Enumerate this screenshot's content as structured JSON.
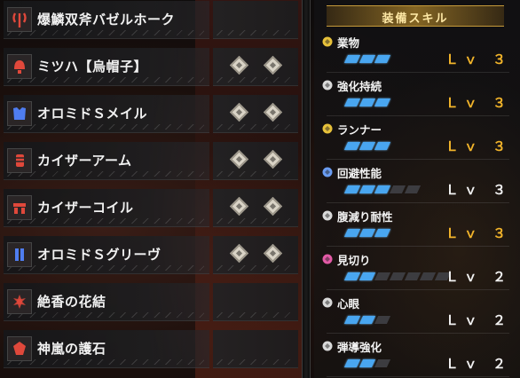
{
  "equipment": [
    {
      "name": "爆鱗双斧バゼルホーク",
      "icon": "weapon-switch-axe-icon",
      "icon_color": "#e0483b",
      "slots": 0
    },
    {
      "name": "ミツハ【烏帽子】",
      "icon": "helmet-icon",
      "icon_color": "#e0483b",
      "slots": 2
    },
    {
      "name": "オロミドＳメイル",
      "icon": "chest-armor-icon",
      "icon_color": "#4f7df0",
      "slots": 2
    },
    {
      "name": "カイザーアーム",
      "icon": "arm-armor-icon",
      "icon_color": "#e0483b",
      "slots": 2
    },
    {
      "name": "カイザーコイル",
      "icon": "waist-armor-icon",
      "icon_color": "#e0483b",
      "slots": 2
    },
    {
      "name": "オロミドＳグリーヴ",
      "icon": "leg-armor-icon",
      "icon_color": "#4f7df0",
      "slots": 2
    },
    {
      "name": "絶香の花結",
      "icon": "charm-flower-icon",
      "icon_color": "#e0483b",
      "slots": 0
    },
    {
      "name": "神嵐の護石",
      "icon": "talisman-icon",
      "icon_color": "#e0483b",
      "slots": 0
    }
  ],
  "skills_header": "装備スキル",
  "skills": [
    {
      "name": "業物",
      "level_text": "Ｌｖ ３",
      "level": 3,
      "max": 3,
      "maxed": true,
      "icon": "skill-icon-yellow",
      "icon_color": "#e7c13a"
    },
    {
      "name": "強化持続",
      "level_text": "Ｌｖ ３",
      "level": 3,
      "max": 3,
      "maxed": true,
      "icon": "skill-icon-white",
      "icon_color": "#d9d9d9"
    },
    {
      "name": "ランナー",
      "level_text": "Ｌｖ ３",
      "level": 3,
      "max": 3,
      "maxed": true,
      "icon": "skill-icon-yellow",
      "icon_color": "#e7c13a"
    },
    {
      "name": "回避性能",
      "level_text": "Ｌｖ ３",
      "level": 3,
      "max": 5,
      "maxed": false,
      "icon": "skill-icon-blue",
      "icon_color": "#6a9cf2"
    },
    {
      "name": "腹減り耐性",
      "level_text": "Ｌｖ ３",
      "level": 3,
      "max": 3,
      "maxed": true,
      "icon": "skill-icon-white",
      "icon_color": "#d9d9d9"
    },
    {
      "name": "見切り",
      "level_text": "Ｌｖ ２",
      "level": 2,
      "max": 7,
      "maxed": false,
      "icon": "skill-icon-pink",
      "icon_color": "#e35aa6"
    },
    {
      "name": "心眼",
      "level_text": "Ｌｖ ２",
      "level": 2,
      "max": 3,
      "maxed": false,
      "icon": "skill-icon-white",
      "icon_color": "#d9d9d9"
    },
    {
      "name": "弾導強化",
      "level_text": "Ｌｖ ２",
      "level": 2,
      "max": 3,
      "maxed": false,
      "icon": "skill-icon-white",
      "icon_color": "#d9d9d9"
    }
  ]
}
